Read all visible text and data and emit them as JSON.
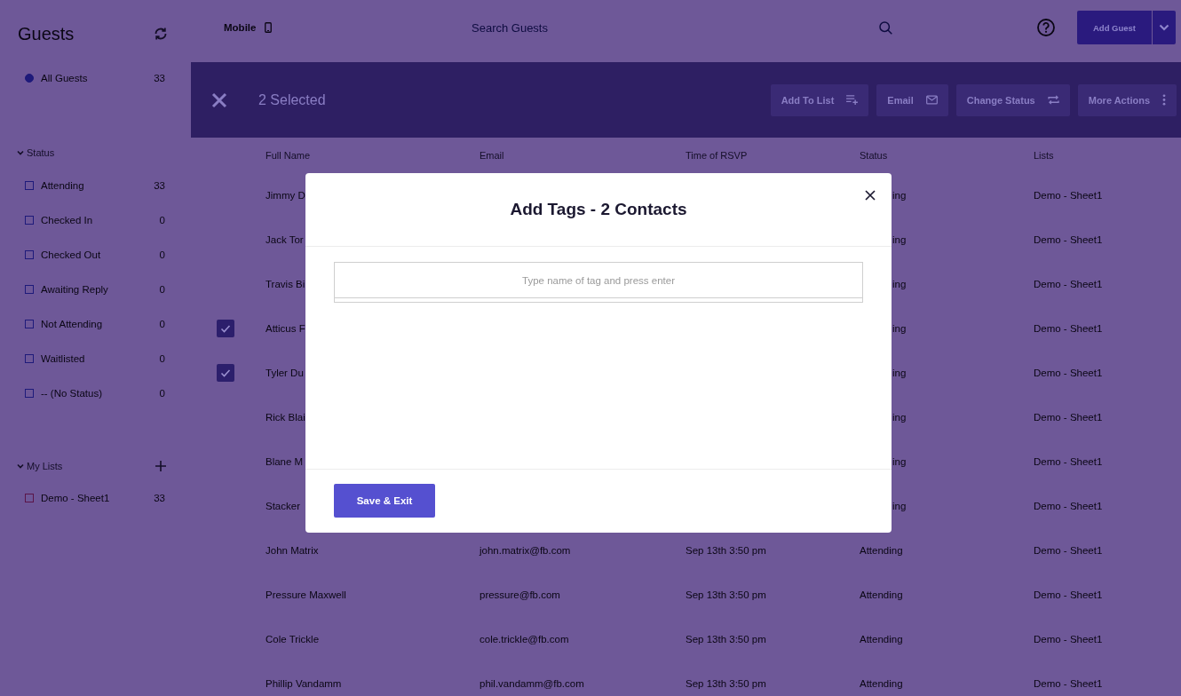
{
  "sidebar": {
    "title": "Guests",
    "all_guests": {
      "label": "All Guests",
      "count": "33",
      "selected": true
    },
    "status_section": {
      "label": "Status",
      "expanded": true,
      "items": [
        {
          "label": "Attending",
          "count": "33",
          "checked": false
        },
        {
          "label": "Checked In",
          "count": "0",
          "checked": false
        },
        {
          "label": "Checked Out",
          "count": "0",
          "checked": false
        },
        {
          "label": "Awaiting Reply",
          "count": "0",
          "checked": false
        },
        {
          "label": "Not Attending",
          "count": "0",
          "checked": false
        },
        {
          "label": "Waitlisted",
          "count": "0",
          "checked": false
        },
        {
          "label": "-- (No Status)",
          "count": "0",
          "checked": false
        }
      ]
    },
    "lists_section": {
      "label": "My Lists",
      "expanded": true,
      "items": [
        {
          "label": "Demo - Sheet1",
          "count": "33",
          "checked": false,
          "color": "#5a1448"
        }
      ]
    }
  },
  "top_bar": {
    "view_label": "Mobile",
    "search": {
      "placeholder": "Search Guests"
    },
    "add_button": "Add Guest"
  },
  "selection_bar": {
    "count_label": "2 Selected",
    "actions": [
      {
        "label": "Add To List",
        "kind": "add-list"
      },
      {
        "label": "Email",
        "kind": "email"
      },
      {
        "label": "Change Status",
        "kind": "swap"
      },
      {
        "label": "More Actions",
        "kind": "more"
      }
    ]
  },
  "table": {
    "columns": [
      "Full Name",
      "Email",
      "Time of RSVP",
      "Status",
      "Lists"
    ],
    "rows": [
      {
        "kind": "covered",
        "checked": false,
        "name": "Jimmy D",
        "status": "ing",
        "lists": "Demo - Sheet1"
      },
      {
        "kind": "covered",
        "checked": false,
        "name": "Jack Tor",
        "status": "ing",
        "lists": "Demo - Sheet1"
      },
      {
        "kind": "covered",
        "checked": false,
        "name": "Travis Bi",
        "status": "ing",
        "lists": "Demo - Sheet1"
      },
      {
        "kind": "covered",
        "checked": true,
        "name": "Atticus F",
        "status": "ing",
        "lists": "Demo - Sheet1"
      },
      {
        "kind": "covered",
        "checked": true,
        "name": "Tyler Du",
        "status": "ing",
        "lists": "Demo - Sheet1"
      },
      {
        "kind": "covered",
        "checked": false,
        "name": "Rick Blai",
        "status": "ing",
        "lists": "Demo - Sheet1"
      },
      {
        "kind": "covered",
        "checked": false,
        "name": "Blane M",
        "status": "ing",
        "lists": "Demo - Sheet1"
      },
      {
        "kind": "covered",
        "checked": false,
        "name": "Stacker",
        "status": "ing",
        "lists": "Demo - Sheet1"
      },
      {
        "kind": "full",
        "checked": false,
        "name": "John Matrix",
        "email": "john.matrix@fb.com",
        "time": "Sep 13th 3:50 pm",
        "status": "Attending",
        "lists": "Demo - Sheet1"
      },
      {
        "kind": "full",
        "checked": false,
        "name": "Pressure Maxwell",
        "email": "pressure@fb.com",
        "time": "Sep 13th 3:50 pm",
        "status": "Attending",
        "lists": "Demo - Sheet1"
      },
      {
        "kind": "full",
        "checked": false,
        "name": "Cole Trickle",
        "email": "cole.trickle@fb.com",
        "time": "Sep 13th 3:50 pm",
        "status": "Attending",
        "lists": "Demo - Sheet1"
      },
      {
        "kind": "full",
        "checked": false,
        "name": "Phillip Vandamm",
        "email": "phil.vandamm@fb.com",
        "time": "Sep 13th 3:50 pm",
        "status": "Attending",
        "lists": "Demo - Sheet1"
      }
    ]
  },
  "modal": {
    "title": "Add Tags - 2 Contacts",
    "tag_input": {
      "placeholder": "Type name of tag and press enter"
    },
    "save_button": "Save & Exit"
  }
}
